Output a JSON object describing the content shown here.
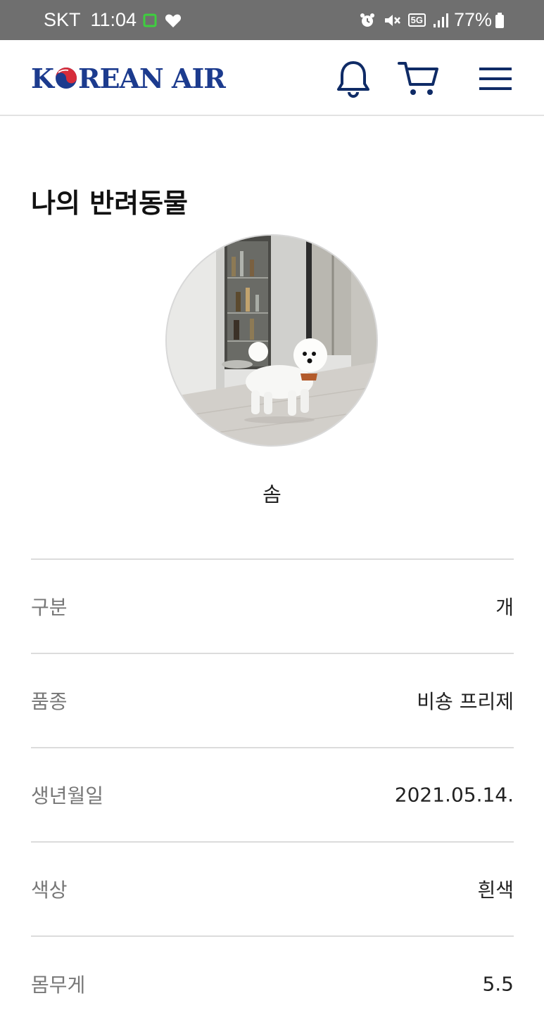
{
  "status_bar": {
    "carrier": "SKT",
    "time": "11:04",
    "network": "5G",
    "battery": "77%"
  },
  "header": {
    "logo_k": "K",
    "logo_rest": "REAN AIR",
    "icons": [
      "bell-icon",
      "cart-icon",
      "menu-icon"
    ]
  },
  "page": {
    "title": "나의 반려동물"
  },
  "pet": {
    "name": "솜",
    "photo": "white dog standing on floor"
  },
  "details": [
    {
      "label": "구분",
      "value": "개"
    },
    {
      "label": "품종",
      "value": "비숑 프리제"
    },
    {
      "label": "생년월일",
      "value": "2021.05.14."
    },
    {
      "label": "색상",
      "value": "흰색"
    },
    {
      "label": "몸무게",
      "value": "5.5"
    }
  ],
  "colors": {
    "brand": "#1c3b8e",
    "status_bar": "#6f6f6f",
    "divider": "#dcdcdc"
  }
}
